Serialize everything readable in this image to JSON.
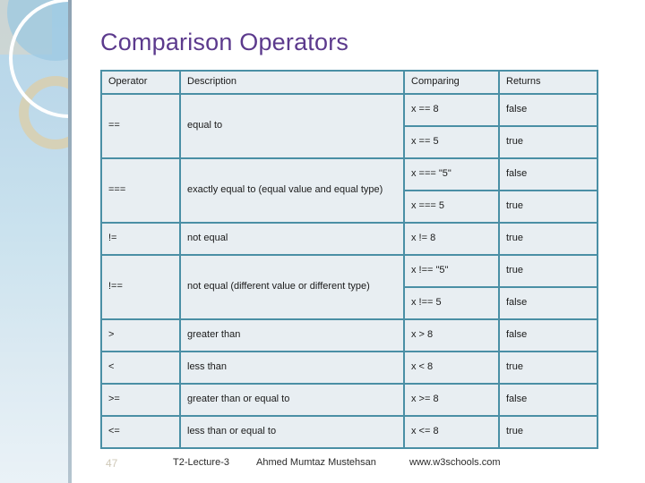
{
  "slide": {
    "title": "Comparison Operators",
    "title_color": "#5c3a8d",
    "number": "47"
  },
  "table": {
    "border_color": "#4a8fa5",
    "cell_background": "#e8eef2",
    "headers": {
      "operator": "Operator",
      "description": "Description",
      "comparing": "Comparing",
      "returns": "Returns"
    },
    "rows": [
      {
        "operator": "==",
        "description": "equal to",
        "examples": [
          {
            "comparing": "x == 8",
            "returns": "false"
          },
          {
            "comparing": "x == 5",
            "returns": "true"
          }
        ]
      },
      {
        "operator": "===",
        "description": "exactly equal to (equal value and equal type)",
        "examples": [
          {
            "comparing": "x === \"5\"",
            "returns": "false"
          },
          {
            "comparing": "x === 5",
            "returns": "true"
          }
        ]
      },
      {
        "operator": "!=",
        "description": "not equal",
        "examples": [
          {
            "comparing": "x != 8",
            "returns": "true"
          }
        ]
      },
      {
        "operator": "!==",
        "description": "not equal (different value or different type)",
        "examples": [
          {
            "comparing": "x !== \"5\"",
            "returns": "true"
          },
          {
            "comparing": "x !== 5",
            "returns": "false"
          }
        ]
      },
      {
        "operator": ">",
        "description": "greater than",
        "examples": [
          {
            "comparing": "x > 8",
            "returns": "false"
          }
        ]
      },
      {
        "operator": "<",
        "description": "less than",
        "examples": [
          {
            "comparing": "x < 8",
            "returns": "true"
          }
        ]
      },
      {
        "operator": ">=",
        "description": "greater than or equal to",
        "examples": [
          {
            "comparing": "x >= 8",
            "returns": "false"
          }
        ]
      },
      {
        "operator": "<=",
        "description": "less than or equal to",
        "examples": [
          {
            "comparing": "x <= 8",
            "returns": "true"
          }
        ]
      }
    ]
  },
  "footer": {
    "lecture": "T2-Lecture-3",
    "author": "Ahmed Mumtaz Mustehsan",
    "source": "www.w3schools.com"
  }
}
